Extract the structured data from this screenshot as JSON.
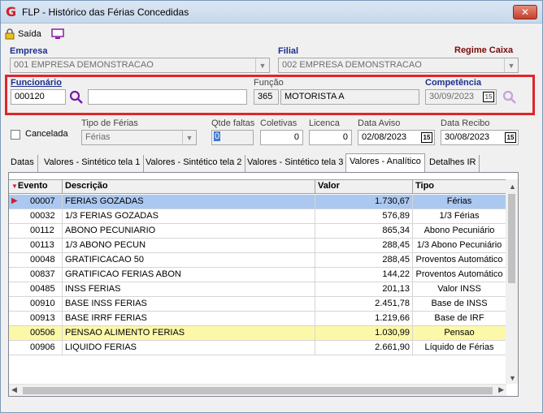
{
  "window": {
    "title": "FLP - Histórico das Férias Concedidas",
    "close_label": "x"
  },
  "toolbar": {
    "exit_label": "Saída"
  },
  "empresa": {
    "label": "Empresa",
    "value": "001 EMPRESA DEMONSTRACAO"
  },
  "filial": {
    "label": "Filial",
    "value": "002 EMPRESA DEMONSTRACAO"
  },
  "regime_label": "Regime Caixa",
  "funcionario": {
    "label": "Funcionário",
    "code": "000120",
    "name": ""
  },
  "funcao": {
    "label": "Função",
    "code": "365",
    "name": "MOTORISTA A"
  },
  "competencia": {
    "label": "Competência",
    "value": "30/09/2023"
  },
  "cancelada_label": "Cancelada",
  "tipo_ferias": {
    "label": "Tipo de Férias",
    "value": "Férias"
  },
  "qtde_faltas": {
    "label": "Qtde faltas",
    "value": "0"
  },
  "coletivas": {
    "label": "Coletivas",
    "value": "0"
  },
  "licenca": {
    "label": "Licenca",
    "value": "0"
  },
  "data_aviso": {
    "label": "Data Aviso",
    "value": "02/08/2023"
  },
  "data_recibo": {
    "label": "Data Recibo",
    "value": "30/08/2023"
  },
  "tabs": [
    "Datas",
    "Valores - Sintético tela 1",
    "Valores - Sintético tela 2",
    "Valores - Sintético tela 3",
    "Valores - Analítico",
    "Detalhes IR"
  ],
  "active_tab": 4,
  "grid": {
    "headers": [
      "Evento",
      "Descrição",
      "Valor",
      "Tipo"
    ],
    "rows": [
      {
        "evento": "00007",
        "descricao": "FERIAS GOZADAS",
        "valor": "1.730,67",
        "tipo": "Férias"
      },
      {
        "evento": "00032",
        "descricao": "1/3 FERIAS GOZADAS",
        "valor": "576,89",
        "tipo": "1/3 Férias"
      },
      {
        "evento": "00112",
        "descricao": "ABONO PECUNIARIO",
        "valor": "865,34",
        "tipo": "Abono Pecuniário"
      },
      {
        "evento": "00113",
        "descricao": "1/3 ABONO PECUN",
        "valor": "288,45",
        "tipo": "1/3 Abono Pecuniário"
      },
      {
        "evento": "00048",
        "descricao": "GRATIFICACAO 50",
        "valor": "288,45",
        "tipo": "Proventos Automático"
      },
      {
        "evento": "00837",
        "descricao": "GRATIFICAO FERIAS ABON",
        "valor": "144,22",
        "tipo": "Proventos Automático"
      },
      {
        "evento": "00485",
        "descricao": "INSS FERIAS",
        "valor": "201,13",
        "tipo": "Valor INSS"
      },
      {
        "evento": "00910",
        "descricao": "BASE INSS FERIAS",
        "valor": "2.451,78",
        "tipo": "Base de INSS"
      },
      {
        "evento": "00913",
        "descricao": "BASE IRRF FERIAS",
        "valor": "1.219,66",
        "tipo": "Base de IRF"
      },
      {
        "evento": "00506",
        "descricao": "PENSAO ALIMENTO FERIAS",
        "valor": "1.030,99",
        "tipo": "Pensao"
      },
      {
        "evento": "00906",
        "descricao": "LIQUIDO FERIAS",
        "valor": "2.661,90",
        "tipo": "Líquido de Férias"
      }
    ]
  },
  "colors": {
    "selected_row": "#aac8f0",
    "highlight_row": "#fcf8a8",
    "label_blue": "#1d2f8c",
    "red_box": "#e0262a"
  }
}
